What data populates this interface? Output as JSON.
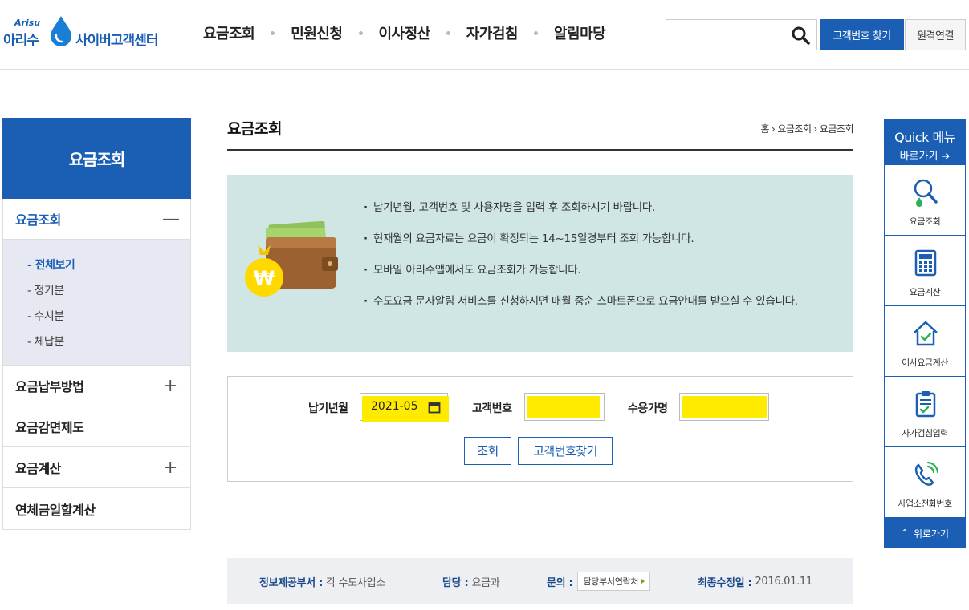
{
  "header": {
    "logo": {
      "en": "Arisu",
      "ko": "아리수",
      "center": "사이버고객센터"
    },
    "gnb": [
      "요금조회",
      "민원신청",
      "이사정산",
      "자가검침",
      "알림마당"
    ],
    "search": {
      "placeholder": ""
    },
    "find_customer_button": "고객번호 찾기",
    "remote_button": "원격연결"
  },
  "sidebar": {
    "title": "요금조회",
    "items": [
      {
        "label": "요금조회",
        "toggle": "—"
      },
      {
        "label": "요금납부방법",
        "toggle": "+"
      },
      {
        "label": "요금감면제도",
        "toggle": ""
      },
      {
        "label": "요금계산",
        "toggle": "+"
      },
      {
        "label": "연체금일할계산",
        "toggle": ""
      }
    ],
    "sub_items": [
      "- 전체보기",
      "- 정기분",
      "- 수시분",
      "- 체납분"
    ]
  },
  "main": {
    "title": "요금조회",
    "breadcrumb": [
      "홈",
      "요금조회",
      "요금조회"
    ],
    "info": [
      "납기년월, 고객번호 및 사용자명을 입력 후 조회하시기 바랍니다.",
      "현재월의 요금자료는 요금이 확정되는 14~15일경부터 조회 가능합니다.",
      "모바일 아리수앱에서도 요금조회가 가능합니다.",
      "수도요금 문자알림 서비스를 신청하시면 매월 중순 스마트폰으로 요금안내를 받으실 수 있습니다."
    ],
    "wallet_symbol": "₩",
    "form": {
      "month_label": "납기년월",
      "month_value": "2021-05",
      "customer_label": "고객번호",
      "customer_value": "",
      "user_label": "수용가명",
      "user_value": "",
      "search_button": "조회",
      "find_button": "고객번호찾기"
    }
  },
  "footer_info": {
    "provider_label": "정보제공부서 :",
    "provider_value": "각 수도사업소",
    "manager_label": "담당 :",
    "manager_value": "요금과",
    "inquiry_label": "문의 :",
    "inquiry_button": "담당부서연락처",
    "modified_label": "최종수정일 :",
    "modified_value": "2016.01.11"
  },
  "quick_menu": {
    "title": "Quick 메뉴",
    "subtitle": "바로가기 ➔",
    "items": [
      "요금조회",
      "요금계산",
      "이사요금계산",
      "자가검침입력",
      "사업소전화번호"
    ],
    "top_button": "위로가기"
  },
  "colors": {
    "brand": "#1a5fb4",
    "info_bg": "#cfe6e5",
    "highlight": "#ffeb00",
    "sub_bg": "#e7e9f2"
  }
}
